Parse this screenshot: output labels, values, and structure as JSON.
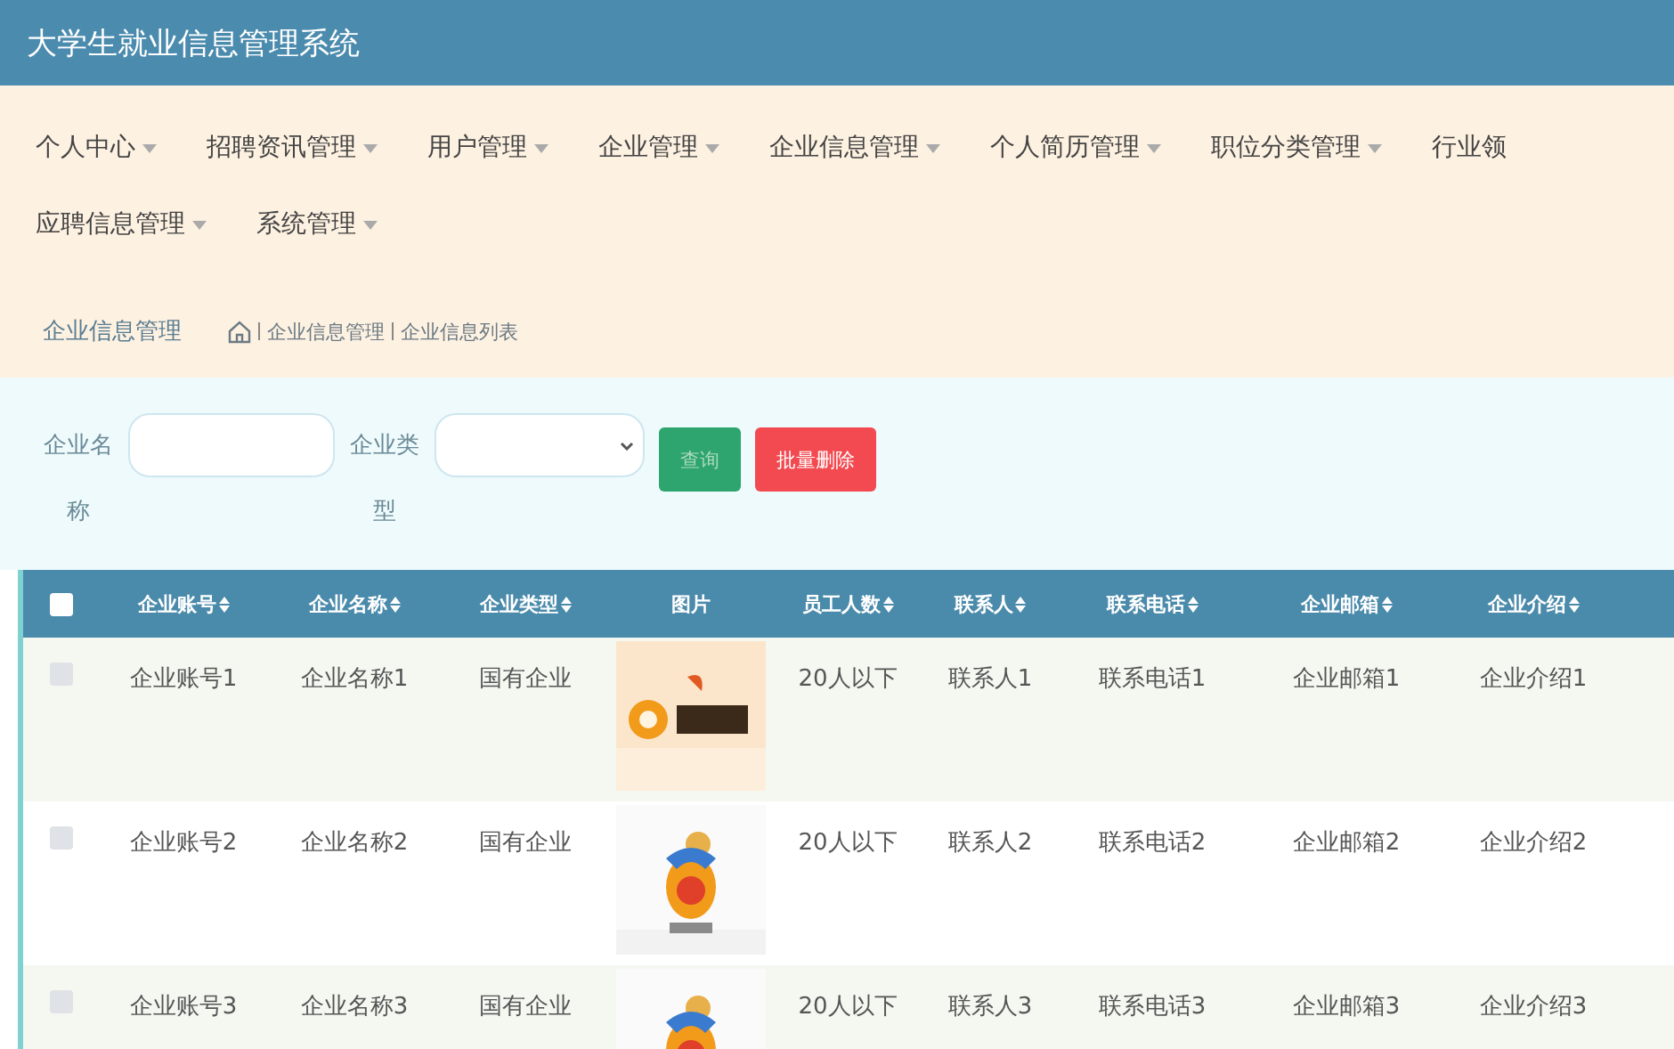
{
  "window": {
    "title": "大学生就业信息管理系统"
  },
  "menu": [
    {
      "label": "个人中心"
    },
    {
      "label": "招聘资讯管理"
    },
    {
      "label": "用户管理"
    },
    {
      "label": "企业管理"
    },
    {
      "label": "企业信息管理"
    },
    {
      "label": "个人简历管理"
    },
    {
      "label": "职位分类管理"
    },
    {
      "label": "行业领"
    },
    {
      "label": "应聘信息管理"
    },
    {
      "label": "系统管理"
    }
  ],
  "breadcrumb": {
    "title": "企业信息管理",
    "path": [
      "企业信息管理",
      "企业信息列表"
    ]
  },
  "search": {
    "fields": [
      {
        "label": "企业名称",
        "kind": "text"
      },
      {
        "label": "企业类型",
        "kind": "select"
      }
    ],
    "buttons": [
      {
        "label": "查询",
        "kind": "query"
      },
      {
        "label": "批量删除",
        "kind": "delete"
      }
    ]
  },
  "table": {
    "select_all": {
      "checked": false
    },
    "columns": [
      {
        "label": "企业账号",
        "sortable": true
      },
      {
        "label": "企业名称",
        "sortable": true
      },
      {
        "label": "企业类型",
        "sortable": true
      },
      {
        "label": "图片",
        "sortable": false
      },
      {
        "label": "员工人数",
        "sortable": true
      },
      {
        "label": "联系人",
        "sortable": true
      },
      {
        "label": "联系电话",
        "sortable": true
      },
      {
        "label": "企业邮箱",
        "sortable": true
      },
      {
        "label": "企业介绍",
        "sortable": true
      }
    ],
    "rows": [
      {
        "checked": false,
        "cells": [
          "企业账号1",
          "企业名称1",
          "国有企业",
          {
            "kind": "picture"
          },
          "20人以下",
          "联系人1",
          "联系电话1",
          "企业邮箱1",
          "企业介绍1"
        ]
      },
      {
        "checked": false,
        "cells": [
          "企业账号2",
          "企业名称2",
          "国有企业",
          {
            "kind": "picture"
          },
          "20人以下",
          "联系人2",
          "联系电话2",
          "企业邮箱2",
          "企业介绍2"
        ]
      },
      {
        "checked": false,
        "cells": [
          "企业账号3",
          "企业名称3",
          "国有企业",
          {
            "kind": "picture"
          },
          "20人以下",
          "联系人3",
          "联系电话3",
          "企业邮箱3",
          "企业介绍3"
        ]
      }
    ]
  }
}
